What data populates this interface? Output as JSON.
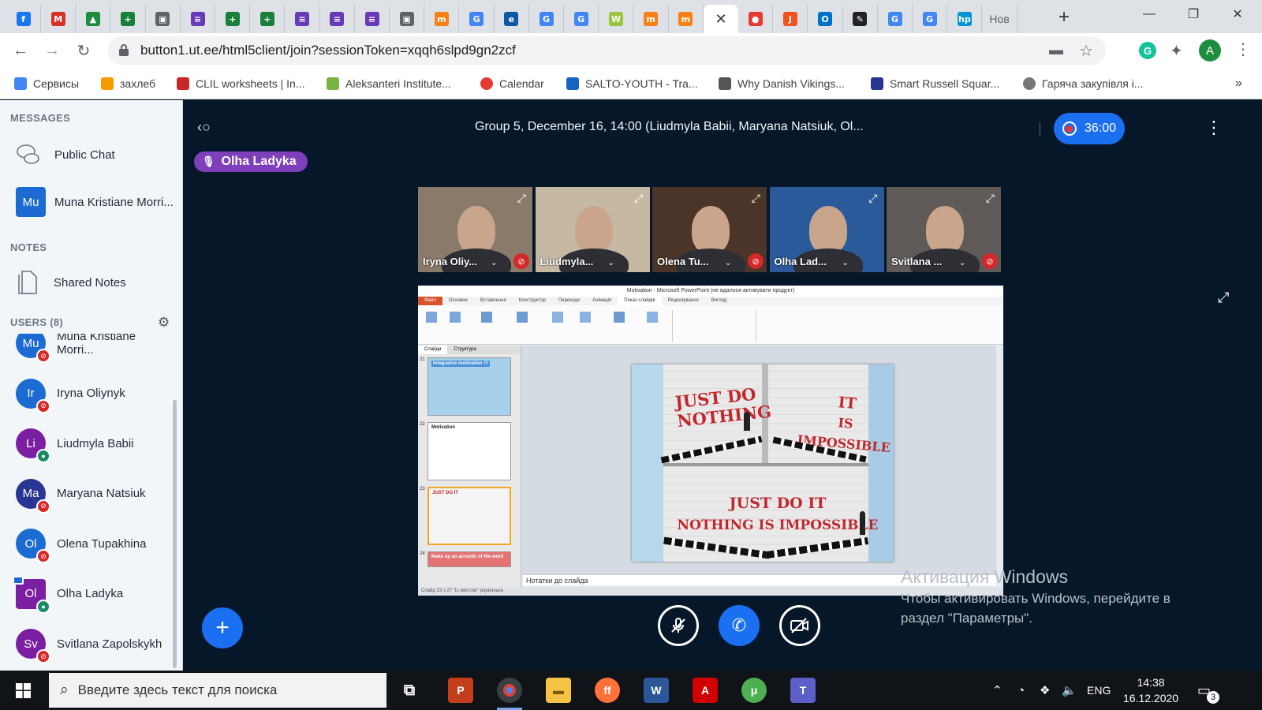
{
  "browser": {
    "tabs": [
      {
        "icon": "facebook-icon",
        "glyph": "f",
        "color": "#1877f2"
      },
      {
        "icon": "gmail-icon",
        "glyph": "M",
        "color": "#d93025"
      },
      {
        "icon": "drive-icon",
        "glyph": "▲",
        "color": "#1e8e3e"
      },
      {
        "icon": "sheets-icon",
        "glyph": "+",
        "color": "#188038"
      },
      {
        "icon": "classroom-icon",
        "glyph": "▣",
        "color": "#5f6368"
      },
      {
        "icon": "forms-icon",
        "glyph": "≡",
        "color": "#673ab7"
      },
      {
        "icon": "sheets-icon",
        "glyph": "+",
        "color": "#188038"
      },
      {
        "icon": "sheets-icon",
        "glyph": "+",
        "color": "#188038"
      },
      {
        "icon": "forms-icon",
        "glyph": "≡",
        "color": "#673ab7"
      },
      {
        "icon": "forms-icon",
        "glyph": "≡",
        "color": "#673ab7"
      },
      {
        "icon": "forms-icon",
        "glyph": "≡",
        "color": "#673ab7"
      },
      {
        "icon": "classroom-icon",
        "glyph": "▣",
        "color": "#5f6368"
      },
      {
        "icon": "moodle-icon",
        "glyph": "m",
        "color": "#f98012"
      },
      {
        "icon": "google-icon",
        "glyph": "G",
        "color": "#4285f4"
      },
      {
        "icon": "edge-icon",
        "glyph": "e",
        "color": "#0c59a4"
      },
      {
        "icon": "google-icon",
        "glyph": "G",
        "color": "#4285f4"
      },
      {
        "icon": "google-icon",
        "glyph": "G",
        "color": "#4285f4"
      },
      {
        "icon": "wordwall-icon",
        "glyph": "W",
        "color": "#9bc53d"
      },
      {
        "icon": "moodle-icon",
        "glyph": "m",
        "color": "#f98012"
      },
      {
        "icon": "moodle-icon",
        "glyph": "m",
        "color": "#f98012"
      },
      {
        "icon": "bigbluebutton-icon",
        "glyph": "",
        "color": "#ffffff",
        "active": true
      },
      {
        "icon": "record-icon",
        "glyph": "●",
        "color": "#e53935"
      },
      {
        "icon": "jamboard-icon",
        "glyph": "J",
        "color": "#f4511e"
      },
      {
        "icon": "outlook-icon",
        "glyph": "O",
        "color": "#0072c6"
      },
      {
        "icon": "signature-icon",
        "glyph": "✎",
        "color": "#222222"
      },
      {
        "icon": "google-icon",
        "glyph": "G",
        "color": "#4285f4"
      },
      {
        "icon": "google-icon",
        "glyph": "G",
        "color": "#4285f4"
      },
      {
        "icon": "hp-icon",
        "glyph": "hp",
        "color": "#0096d6"
      }
    ],
    "last_tab_label": "Нов",
    "url": "button1.ut.ee/html5client/join?sessionToken=xqqh6slpd9gn2zcf",
    "profile_initial": "A",
    "bookmarks": [
      {
        "label": "Сервисы",
        "icon": "apps-grid-icon",
        "color": "#4285f4"
      },
      {
        "label": "захлеб",
        "icon": "bookmark-icon",
        "color": "#f59b00"
      },
      {
        "label": "CLIL worksheets | In...",
        "icon": "bookmark-icon",
        "color": "#c62828"
      },
      {
        "label": "Aleksanteri Institute...",
        "icon": "bookmark-icon",
        "color": "#7cb342"
      },
      {
        "label": "Calendar",
        "icon": "calendar-icon",
        "color": "#e53935"
      },
      {
        "label": "SALTO-YOUTH - Tra...",
        "icon": "bookmark-icon",
        "color": "#1565c0"
      },
      {
        "label": "Why Danish Vikings...",
        "icon": "bookmark-icon",
        "color": "#555555"
      },
      {
        "label": "Smart Russell Squar...",
        "icon": "bookmark-icon",
        "color": "#283593"
      },
      {
        "label": "Гаряча закупівля і...",
        "icon": "globe-icon",
        "color": "#777777"
      }
    ]
  },
  "sidebar": {
    "messages_header": "MESSAGES",
    "public_chat": "Public Chat",
    "private_chat": {
      "initials": "Mu",
      "name": "Muna Kristiane Morri..."
    },
    "notes_header": "NOTES",
    "shared_notes": "Shared Notes",
    "users_header": "USERS (8)",
    "users": [
      {
        "initials": "Mu",
        "name": "Muna Kristiane Morri...",
        "color": "#1c6bd3",
        "mic": "muted"
      },
      {
        "initials": "Ir",
        "name": "Iryna Oliynyk",
        "color": "#1c6bd3",
        "mic": "muted"
      },
      {
        "initials": "Li",
        "name": "Liudmyla Babii",
        "color": "#7b1fa2",
        "mic": "on"
      },
      {
        "initials": "Ma",
        "name": "Maryana Natsiuk",
        "color": "#283593",
        "mic": "muted"
      },
      {
        "initials": "Ol",
        "name": "Olena Tupakhina",
        "color": "#1c6bd3",
        "mic": "muted"
      },
      {
        "initials": "Ol",
        "name": "Olha Ladyka",
        "color": "#7b1fa2",
        "mic": "on",
        "presenter": true
      },
      {
        "initials": "Sv",
        "name": "Svitlana Zapolskykh",
        "color": "#7b1fa2",
        "mic": "muted"
      }
    ]
  },
  "meeting": {
    "title": "Group 5, December 16, 14:00 (Liudmyla Babii, Maryana Natsiuk, Ol...",
    "timer": "36:00",
    "talking": "Olha Ladyka",
    "videos": [
      {
        "label": "Iryna Oliy...",
        "mic": "muted",
        "bg": "#8a7a6a"
      },
      {
        "label": "Liudmyla...",
        "mic": "on",
        "bg": "#c6b9a4"
      },
      {
        "label": "Olena Tu...",
        "mic": "muted",
        "bg": "#4a3528"
      },
      {
        "label": "Olha Lad...",
        "mic": "on",
        "bg": "#2a5a9a"
      },
      {
        "label": "Svitlana ...",
        "mic": "muted",
        "bg": "#5f5a58"
      }
    ]
  },
  "presentation": {
    "app_title": "Motivation - Microsoft PowerPoint (не вдалося активувати продукт)",
    "ribbon_tabs": [
      "Файл",
      "Основне",
      "Вставлення",
      "Конструктор",
      "Переходи",
      "Анімація",
      "Показ слайдів",
      "Рецензування",
      "Вигляд"
    ],
    "panel_tabs": [
      "Слайди",
      "Структура"
    ],
    "thumbs": [
      {
        "num": "21",
        "title": "Integrative motivation !!!"
      },
      {
        "num": "22",
        "title": "Motivation"
      },
      {
        "num": "23",
        "title": "JUST DO IT"
      },
      {
        "num": "24",
        "title": "Make up an acrostic of the word"
      }
    ],
    "slide_words": {
      "a1": "JUST DO",
      "a2": "NOTHING",
      "b1": "IT",
      "b2": "IS IMPOSSIBLE",
      "c1": "JUST DO IT",
      "c2": "NOTHING IS IMPOSSIBLE"
    },
    "notes_placeholder": "Нотатки до слайда",
    "status": "Слайд 23 з 27   \"Із змістом\"   українська"
  },
  "watermark": {
    "line1": "Активация Windows",
    "line2": "Чтобы активировать Windows, перейдите в",
    "line3": "раздел \"Параметры\"."
  },
  "taskbar": {
    "search_placeholder": "Введите здесь текст для поиска",
    "lang": "ENG",
    "time": "14:38",
    "date": "16.12.2020",
    "notifications": "3"
  }
}
